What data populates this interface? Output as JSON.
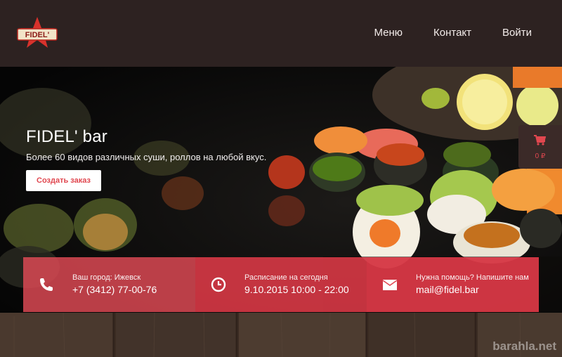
{
  "header": {
    "logo_text": "FIDEL'",
    "nav": [
      "Меню",
      "Контакт",
      "Войти"
    ]
  },
  "hero": {
    "title": "FIDEL' bar",
    "subtitle": "Более 60 видов различных суши, роллов на любой вкус.",
    "order_button": "Создать заказ"
  },
  "cart": {
    "icon": "cart-icon",
    "total": "0 ₽"
  },
  "info": [
    {
      "icon": "phone-icon",
      "label": "Ваш город: Ижевск",
      "value": "+7 (3412) 77-00-76"
    },
    {
      "icon": "clock-icon",
      "label": "Расписание на сегодня",
      "value": "9.10.2015 10:00 - 22:00"
    },
    {
      "icon": "envelope-icon",
      "label": "Нужна помощь? Напишите нам",
      "value": "mail@fidel.bar"
    }
  ],
  "watermark": "barahla.net",
  "colors": {
    "header_bg": "#2d2221",
    "accent": "#e0474f",
    "info_bg": "#e24a56"
  }
}
